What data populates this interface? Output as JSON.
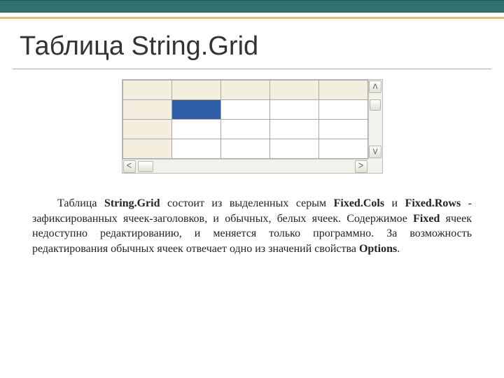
{
  "title": "Таблица String.Grid",
  "body": {
    "pre1": "Таблица",
    "bold1": "String.Grid",
    "t1": " состоит из выделенных серым ",
    "bold2": "Fixed.Cols",
    "t2": " и ",
    "bold3": "Fixed.Rows",
    "t3": " -   зафиксированных   ячеек-заголовков, и обычных, белых ячеек. Содержимое ",
    "bold4": "Fixed",
    "t4": " ячеек недоступно редактированию, и меняется только программно. За возможность редактирования обычных ячеек отвечает одно из значений свойства ",
    "bold5": "Options",
    "t5": "."
  },
  "scroll": {
    "up": "ᐱ",
    "down": "ᐯ",
    "left": "ᐸ",
    "right": "ᐳ"
  }
}
